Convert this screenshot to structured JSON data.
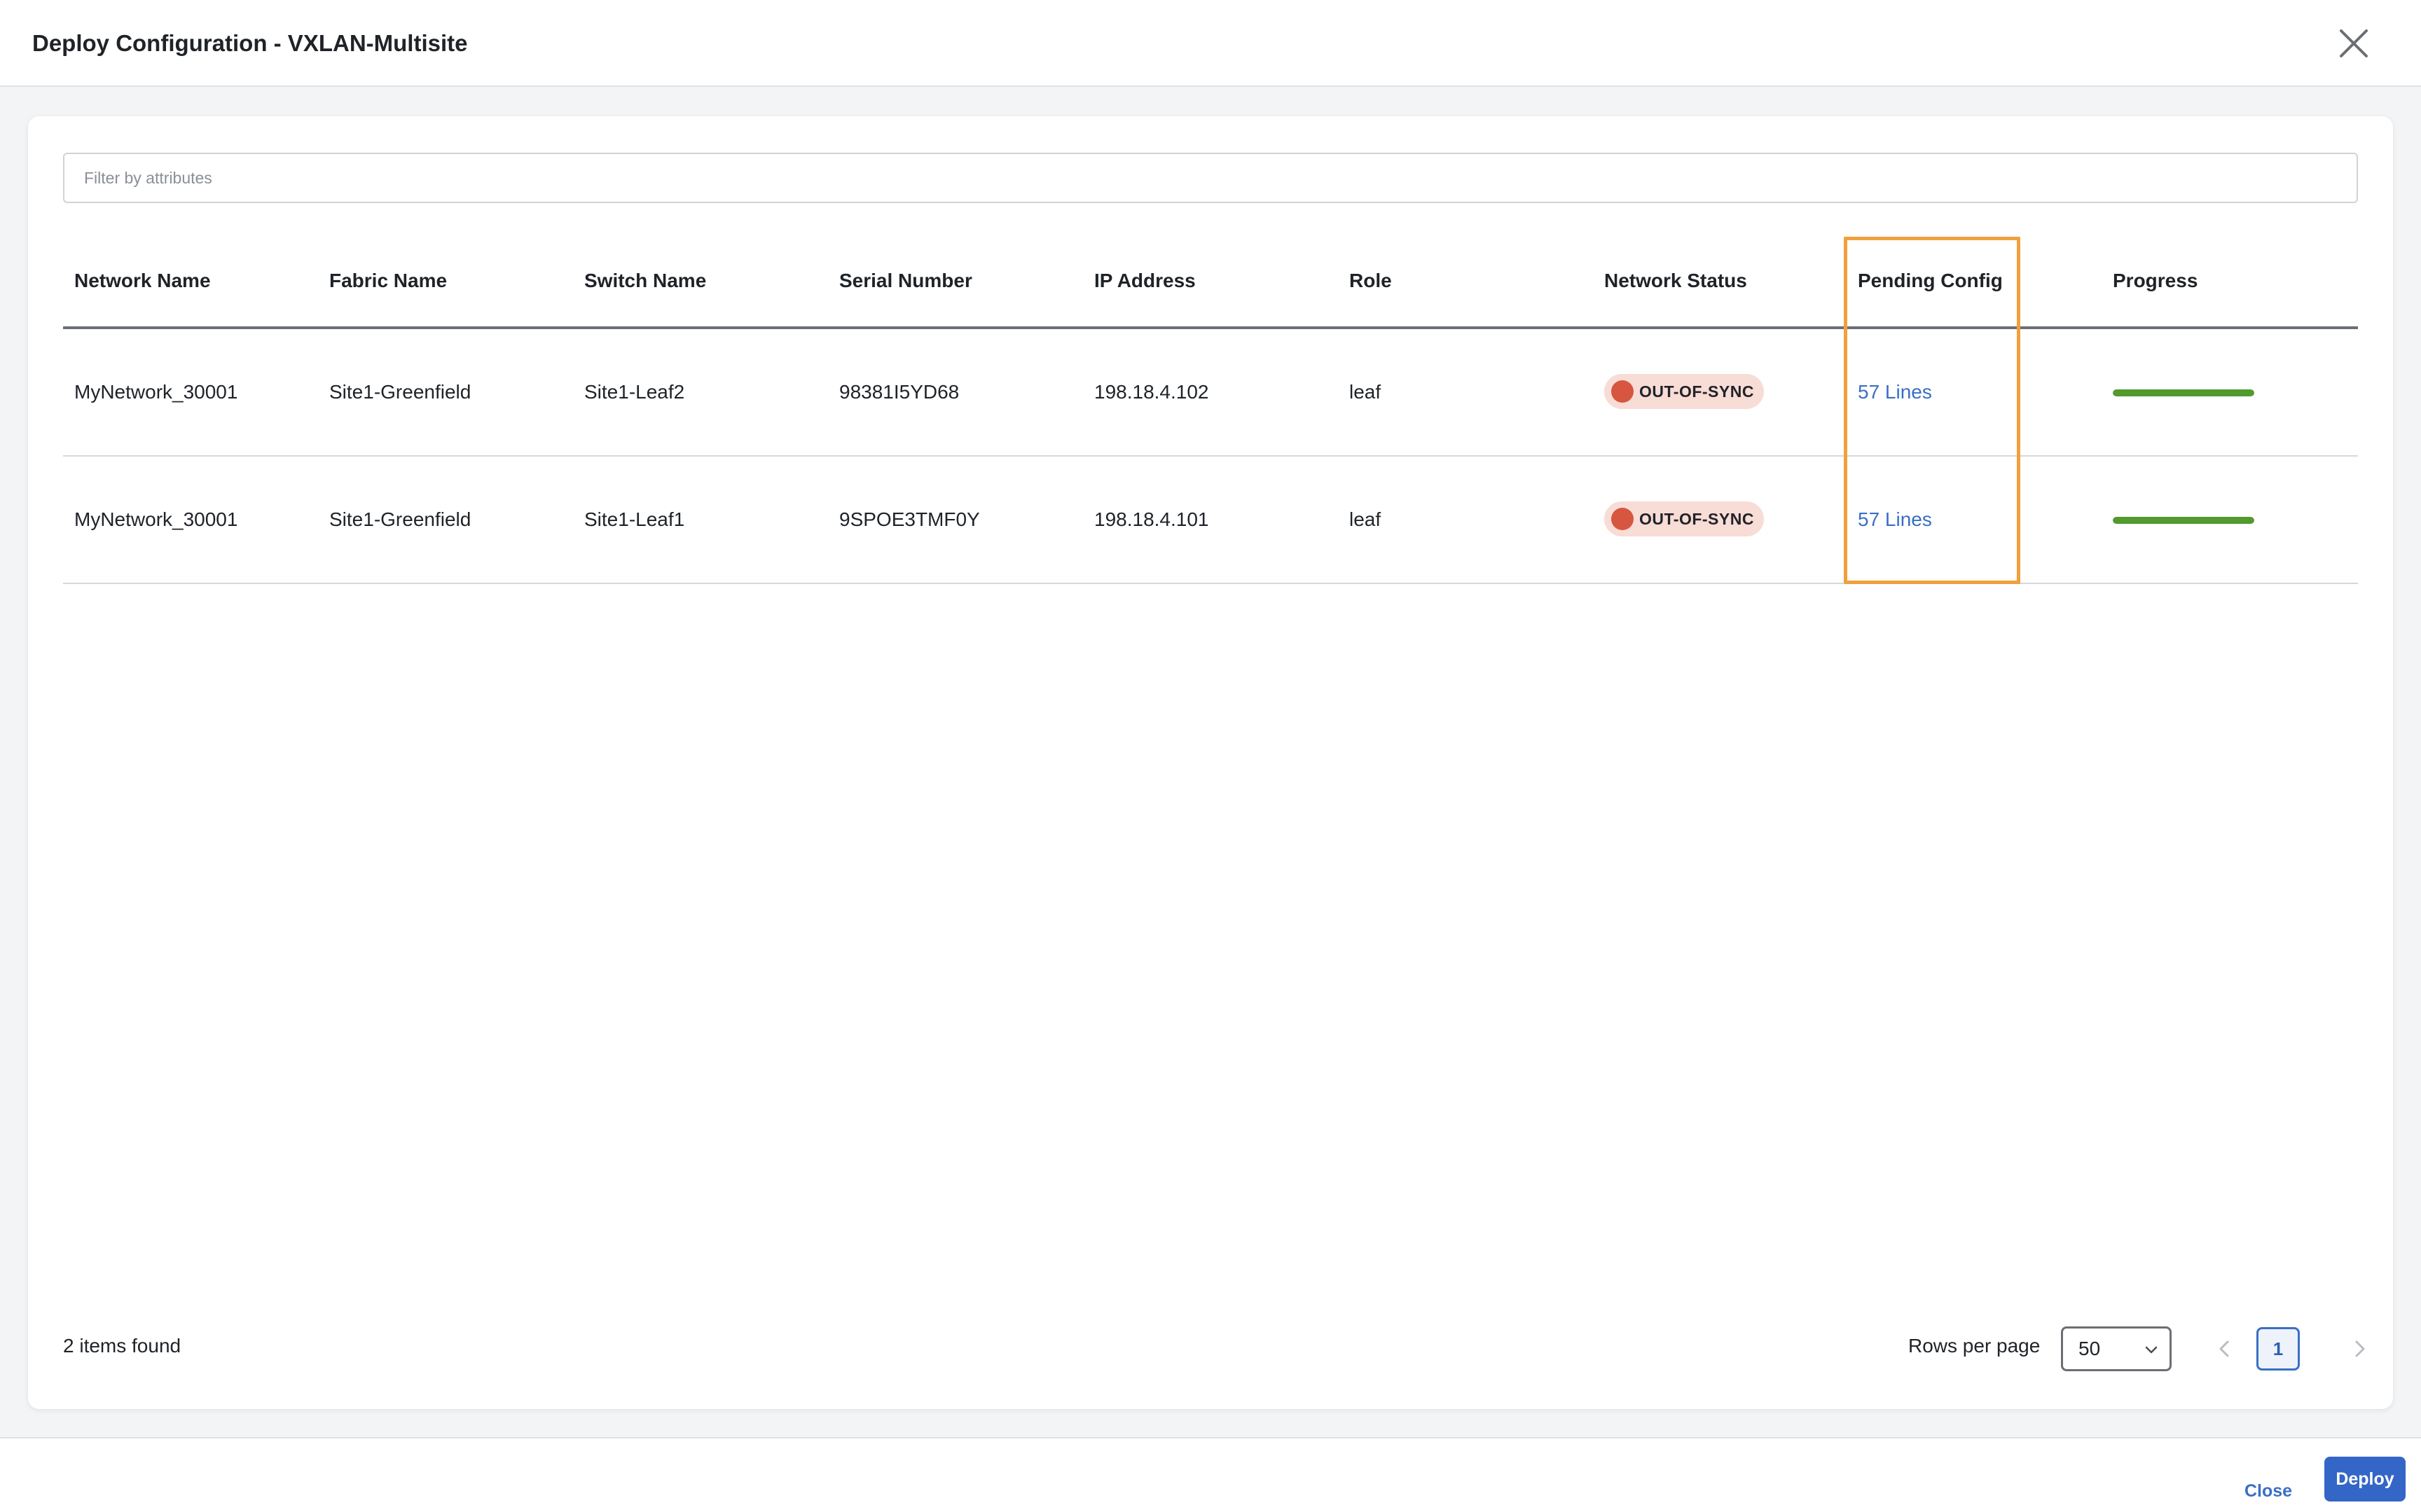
{
  "dialog": {
    "title": "Deploy Configuration - VXLAN-Multisite",
    "close_icon": "close-icon"
  },
  "filter": {
    "placeholder": "Filter by attributes",
    "value": ""
  },
  "table": {
    "columns": [
      "Network Name",
      "Fabric Name",
      "Switch Name",
      "Serial Number",
      "IP Address",
      "Role",
      "Network Status",
      "Pending Config",
      "Progress"
    ],
    "rows": [
      {
        "network_name": "MyNetwork_30001",
        "fabric_name": "Site1-Greenfield",
        "switch_name": "Site1-Leaf2",
        "serial_number": "98381I5YD68",
        "ip_address": "198.18.4.102",
        "role": "leaf",
        "network_status": "OUT-OF-SYNC",
        "pending_config": "57 Lines",
        "progress": 1.0
      },
      {
        "network_name": "MyNetwork_30001",
        "fabric_name": "Site1-Greenfield",
        "switch_name": "Site1-Leaf1",
        "serial_number": "9SPOE3TMF0Y",
        "ip_address": "198.18.4.101",
        "role": "leaf",
        "network_status": "OUT-OF-SYNC",
        "pending_config": "57 Lines",
        "progress": 1.0
      }
    ],
    "highlighted_column": "Pending Config"
  },
  "footer": {
    "items_found": "2 items found",
    "rows_per_page_label": "Rows per page",
    "rows_per_page_value": "50",
    "current_page": "1"
  },
  "actions": {
    "close_label": "Close",
    "deploy_label": "Deploy"
  },
  "colors": {
    "accent": "#3366c6",
    "link": "#3a6fc4",
    "status_out_of_sync": "#d6563f",
    "status_badge_bg": "#f8dcd6",
    "progress_fill": "#529a2e",
    "highlight_box": "#f0a03c"
  }
}
